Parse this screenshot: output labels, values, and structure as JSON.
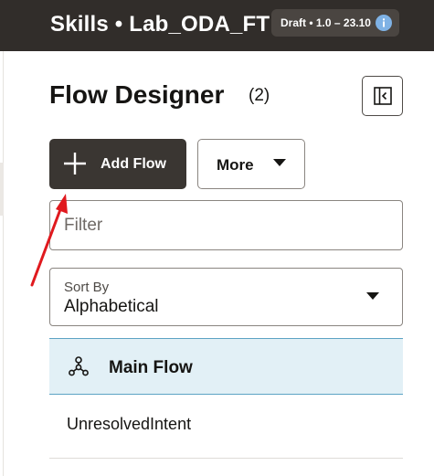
{
  "header": {
    "title": "Skills • Lab_ODA_FT",
    "version_badge": "Draft • 1.0 – 23.10",
    "info_icon": "info-icon"
  },
  "panel": {
    "title": "Flow Designer",
    "count": "(2)",
    "collapse_icon": "collapse-panel-icon"
  },
  "toolbar": {
    "add_flow_label": "Add Flow",
    "more_label": "More"
  },
  "filter": {
    "placeholder": "Filter",
    "value": ""
  },
  "sort": {
    "label": "Sort By",
    "value": "Alphabetical"
  },
  "flows": [
    {
      "label": "Main Flow",
      "selected": true,
      "icon": "flow-tree-icon"
    },
    {
      "label": "UnresolvedIntent",
      "selected": false
    }
  ],
  "colors": {
    "header_bg": "#312d2a",
    "primary_button": "#3a3632",
    "selected_row_bg": "#e2f0f6",
    "selected_row_border": "#5da3c4",
    "annotation_arrow": "#e0191e"
  }
}
